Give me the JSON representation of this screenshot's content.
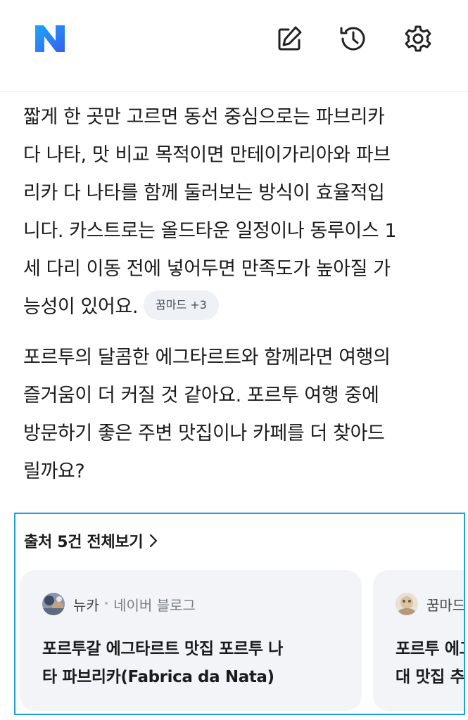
{
  "header": {
    "logo_letter": "N",
    "icons": [
      "new-chat-icon",
      "history-icon",
      "gear-icon"
    ]
  },
  "answer": {
    "paragraph1_lines": [
      "짧게 한 곳만 고르면 동선 중심으로는 파브리카",
      "다 나타, 맛 비교 목적이면 만테이가리아와 파브",
      "리카 다 나타를 함께 둘러보는 방식이 효율적입",
      "니다. 카스트로는 올드타운 일정이나 동루이스 1",
      "세 다리 이동 전에 넣어두면 만족도가 높아질 가",
      "능성이 있어요."
    ],
    "source_chip": "꿈마드 +3",
    "paragraph2_lines": [
      "포르투의 달콤한 에그타르트와 함께라면 여행의",
      "즐거움이 더 커질 것 같아요. 포르투 여행 중에",
      "방문하기 좋은 주변 맛집이나 카페를 더 찾아드",
      "릴까요?"
    ]
  },
  "sources": {
    "header": "출처 5건 전체보기",
    "cards": [
      {
        "author": "뉴카",
        "separator": "•",
        "platform": "네이버 블로그",
        "title_lines": [
          "포르투갈 에그타르트 맛집 포르투 나",
          "타 파브리카(Fabrica da Nata)"
        ]
      },
      {
        "author": "꿈마드",
        "title_lines": [
          "포르투 에그",
          "대 맛집 추"
        ]
      }
    ]
  },
  "colors": {
    "logo_gradient": [
      "#1a9cf5",
      "#2b6bf0"
    ],
    "highlight_border": "#1ea0d8",
    "card_bg": "#f2f4f7",
    "chip_bg": "#eef1f5"
  }
}
